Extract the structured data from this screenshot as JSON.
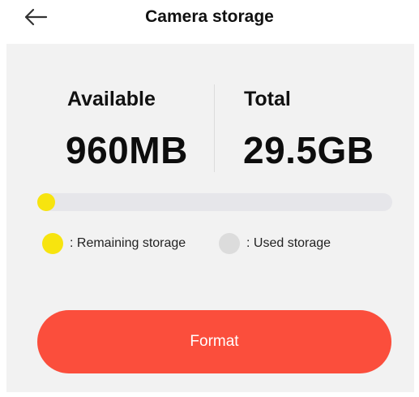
{
  "header": {
    "title": "Camera storage",
    "back_icon": "arrow-left-icon"
  },
  "storage": {
    "available_label": "Available",
    "available_value": "960MB",
    "total_label": "Total",
    "total_value": "29.5GB",
    "used_fraction": 0.03
  },
  "legend": {
    "remaining_label": ": Remaining storage",
    "remaining_color": "#f7e40f",
    "used_label": ": Used storage",
    "used_color": "#dcdcdc"
  },
  "actions": {
    "format_label": "Format",
    "format_color": "#fb4e3c"
  }
}
